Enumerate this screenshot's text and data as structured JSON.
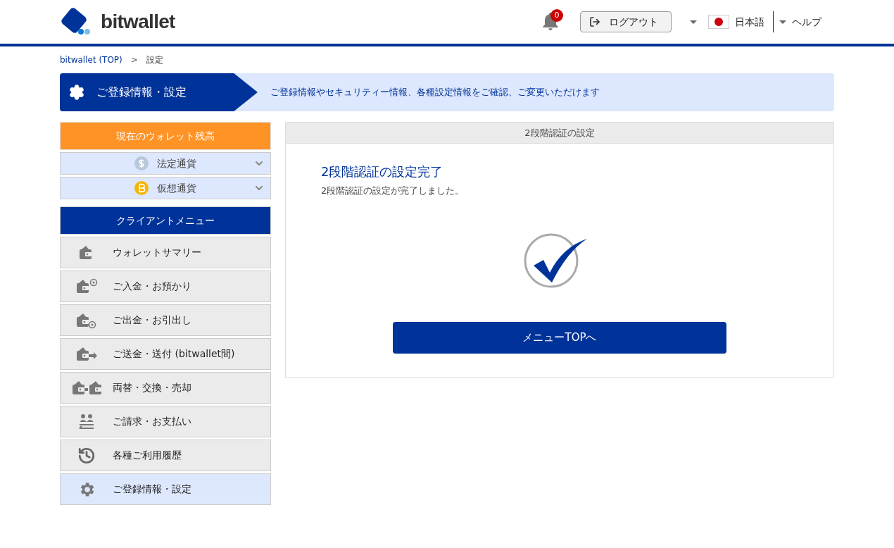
{
  "header": {
    "logo_text": "bitwallet",
    "notifications": {
      "count": "0"
    },
    "logout": "ログアウト",
    "language": "日本語",
    "help": "ヘルプ"
  },
  "breadcrumb": [
    {
      "label": "bitwallet (TOP)",
      "kind": "link"
    },
    {
      "label": ">",
      "kind": "separator"
    },
    {
      "label": "設定",
      "kind": "current"
    }
  ],
  "banner": {
    "title": "ご登録情報・設定",
    "description": "ご登録情報やセキュリティー情報、各種設定情報をご確認、ご変更いただけます"
  },
  "sidebar": {
    "balance_title": "現在のウォレット残高",
    "balances": [
      {
        "label": "法定通貨",
        "kind": "fiat",
        "expanded": false
      },
      {
        "label": "仮想通貨",
        "kind": "crypto",
        "expanded": false
      }
    ],
    "menu_title": "クライアントメニュー",
    "menu": [
      {
        "label": "ウォレットサマリー",
        "kind": "wallet",
        "selected": false
      },
      {
        "label": "ご入金・お預かり",
        "kind": "deposit",
        "selected": false
      },
      {
        "label": "ご出金・お引出し",
        "kind": "withdraw",
        "selected": false
      },
      {
        "label": "ご送金・送付 (bitwallet間)",
        "kind": "transfer",
        "selected": false
      },
      {
        "label": "両替・交換・売却",
        "kind": "exchange",
        "selected": false
      },
      {
        "label": "ご請求・お支払い",
        "kind": "billing",
        "selected": false
      },
      {
        "label": "各種ご利用履歴",
        "kind": "history",
        "selected": false
      },
      {
        "label": "ご登録情報・設定",
        "kind": "settings",
        "selected": true
      }
    ]
  },
  "panel": {
    "header": "2段階認証の設定",
    "title": "2段階認証の設定完了",
    "message": "2段階認証の設定が完了しました。",
    "button": "メニューTOPへ"
  }
}
